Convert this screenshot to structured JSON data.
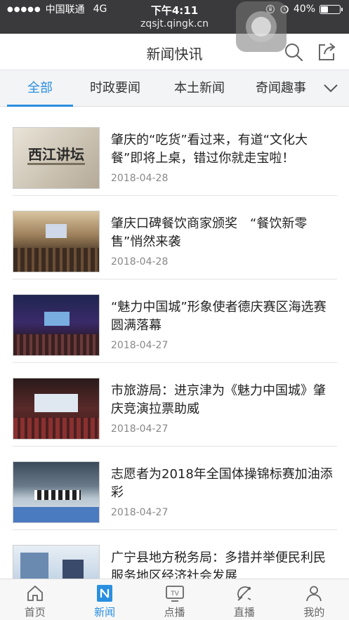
{
  "status_bar": {
    "carrier": "中国联通",
    "network": "4G",
    "time": "下午4:11",
    "battery": "40%",
    "battery_level": 0.4,
    "url": "zqsjt.qingk.cn"
  },
  "header": {
    "title": "新闻快讯"
  },
  "tabs": [
    {
      "label": "全部",
      "active": true
    },
    {
      "label": "时政要闻"
    },
    {
      "label": "本土新闻"
    },
    {
      "label": "奇闻趣事"
    }
  ],
  "thumb1_caption": "西江讲坛",
  "news": [
    {
      "title": "肇庆的“吃货”看过来，有道“文化大餐”即将上桌，错过你就走宝啦！",
      "date": "2018-04-28"
    },
    {
      "title": "肇庆口碑餐饮商家颁奖　“餐饮新零售”悄然来袭",
      "date": "2018-04-28"
    },
    {
      "title": "“魅力中国城”形象使者德庆赛区海选赛圆满落幕",
      "date": "2018-04-27"
    },
    {
      "title": "市旅游局：进京津为《魅力中国城》肇庆竞演拉票助威",
      "date": "2018-04-27"
    },
    {
      "title": "志愿者为2018年全国体操锦标赛加油添彩",
      "date": "2018-04-27"
    },
    {
      "title": "广宁县地方税务局：多措并举便民利民　服务地区经济社会发展",
      "date": ""
    }
  ],
  "bottom_nav": [
    {
      "label": "首页"
    },
    {
      "label": "新闻",
      "active": true
    },
    {
      "label": "点播"
    },
    {
      "label": "直播"
    },
    {
      "label": "我的"
    }
  ],
  "colors": {
    "accent": "#2a8fe0",
    "status_bg": "#3a3a3c"
  }
}
